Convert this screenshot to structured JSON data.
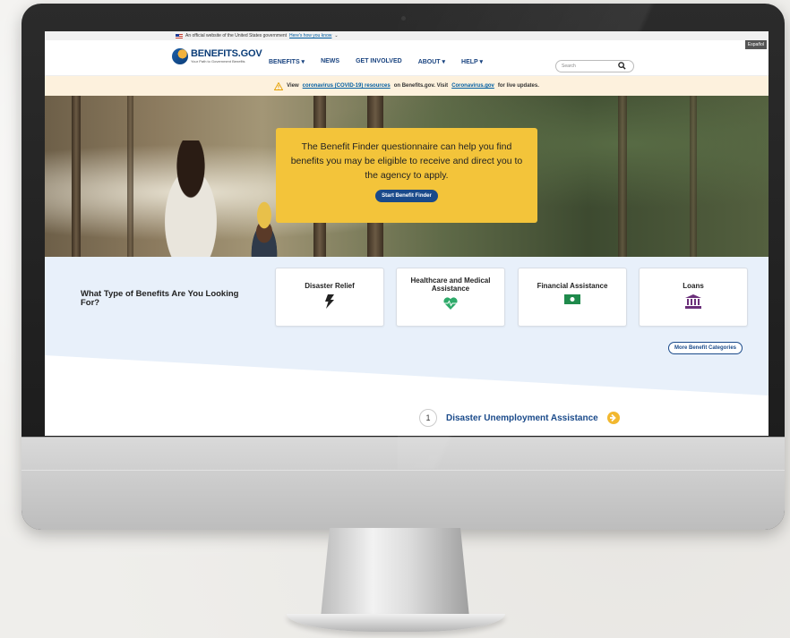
{
  "gov_banner": {
    "text": "An official website of the United States government",
    "link": "Here's how you know"
  },
  "language_toggle": "Español",
  "header": {
    "logo_title": "BENEFITS.GOV",
    "logo_subtitle": "Your Path to Government Benefits",
    "nav": [
      {
        "label": "BENEFITS ▾"
      },
      {
        "label": "NEWS"
      },
      {
        "label": "GET INVOLVED"
      },
      {
        "label": "ABOUT ▾"
      },
      {
        "label": "HELP ▾"
      }
    ],
    "search_placeholder": "Search"
  },
  "alert": {
    "prefix": "View",
    "link1": "coronavirus (COVID-19) resources",
    "middle": "on Benefits.gov. Visit",
    "link2": "Coronavirus.gov",
    "suffix": "for live updates."
  },
  "hero": {
    "text": "The Benefit Finder questionnaire can help you find benefits you may be eligible to receive and direct you to the agency to apply.",
    "button": "Start Benefit Finder"
  },
  "benefits": {
    "heading": "What Type of Benefits Are You Looking For?",
    "cards": [
      {
        "title": "Disaster Relief",
        "icon": "lightning-icon",
        "color": "#222222"
      },
      {
        "title": "Healthcare and Medical Assistance",
        "icon": "heartbeat-icon",
        "color": "#2eaa6a"
      },
      {
        "title": "Financial Assistance",
        "icon": "money-bill-icon",
        "color": "#1f8a4c"
      },
      {
        "title": "Loans",
        "icon": "bank-icon",
        "color": "#6b2f7a"
      }
    ],
    "more_button": "More Benefit Categories"
  },
  "featured": {
    "number": "1",
    "title": "Disaster Unemployment Assistance",
    "arrow_color": "#f2b82f"
  }
}
